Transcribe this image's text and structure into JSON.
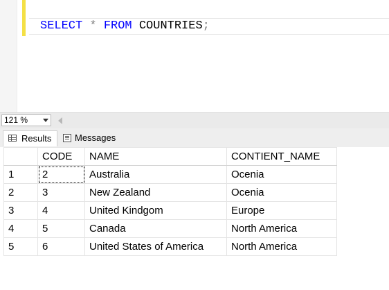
{
  "editor": {
    "tokens": [
      {
        "text": "SELECT",
        "kind": "keyword"
      },
      {
        "text": " ",
        "kind": "space"
      },
      {
        "text": "*",
        "kind": "operator"
      },
      {
        "text": " ",
        "kind": "space"
      },
      {
        "text": "FROM",
        "kind": "keyword"
      },
      {
        "text": " ",
        "kind": "space"
      },
      {
        "text": "COUNTRIES",
        "kind": "identifier"
      },
      {
        "text": ";",
        "kind": "operator"
      }
    ],
    "colors": {
      "keyword": "#0000ff",
      "operator": "#808080",
      "identifier": "#000000"
    }
  },
  "zoom": {
    "value": "121 %"
  },
  "tabs": [
    {
      "label": "Results",
      "icon": "grid-icon",
      "active": true
    },
    {
      "label": "Messages",
      "icon": "messages-icon",
      "active": false
    }
  ],
  "results": {
    "columns": [
      "",
      "CODE",
      "NAME",
      "CONTIENT_NAME"
    ],
    "rows": [
      {
        "num": "1",
        "code": "2",
        "name": "Australia",
        "continent": "Ocenia"
      },
      {
        "num": "2",
        "code": "3",
        "name": "New Zealand",
        "continent": "Ocenia"
      },
      {
        "num": "3",
        "code": "4",
        "name": "United Kindgom",
        "continent": "Europe"
      },
      {
        "num": "4",
        "code": "5",
        "name": "Canada",
        "continent": "North America"
      },
      {
        "num": "5",
        "code": "6",
        "name": "United States of America",
        "continent": "North America"
      }
    ]
  }
}
